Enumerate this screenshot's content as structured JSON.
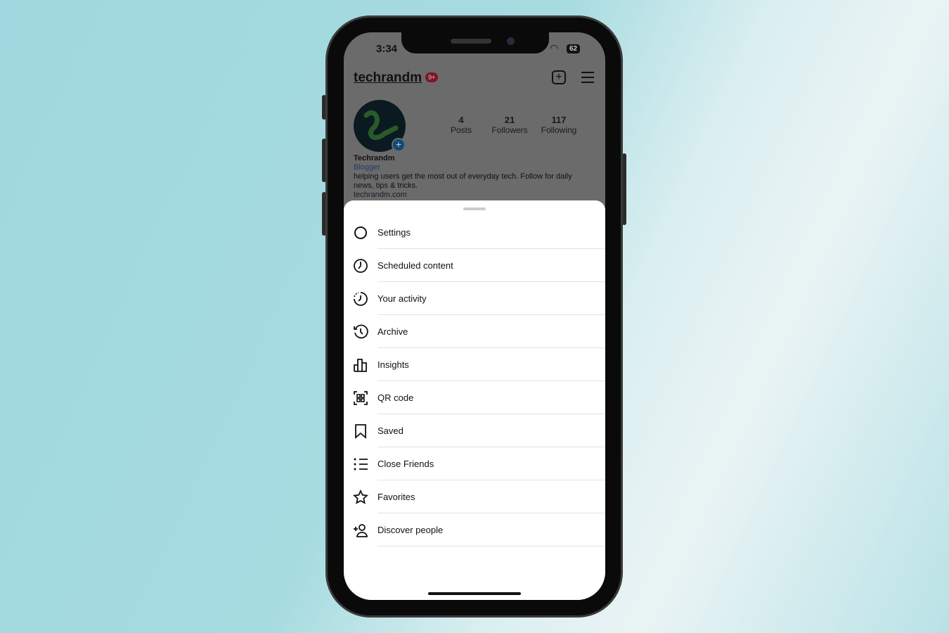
{
  "status_bar": {
    "time": "3:34",
    "battery": "62"
  },
  "profile": {
    "username": "techrandm",
    "notification_badge": "9+",
    "stats": [
      {
        "value": "4",
        "label": "Posts"
      },
      {
        "value": "21",
        "label": "Followers"
      },
      {
        "value": "117",
        "label": "Following"
      }
    ],
    "display_name": "Techrandm",
    "category": "Blogger",
    "bio": "helping users get the most out of everyday tech. Follow for daily news, tips & tricks.",
    "link": "techrandm.com"
  },
  "menu": {
    "items": [
      {
        "label": "Settings",
        "icon": "settings-icon"
      },
      {
        "label": "Scheduled content",
        "icon": "clock-icon"
      },
      {
        "label": "Your activity",
        "icon": "activity-icon",
        "highlighted": true
      },
      {
        "label": "Archive",
        "icon": "archive-icon"
      },
      {
        "label": "Insights",
        "icon": "insights-icon"
      },
      {
        "label": "QR code",
        "icon": "qr-code-icon"
      },
      {
        "label": "Saved",
        "icon": "bookmark-icon"
      },
      {
        "label": "Close Friends",
        "icon": "close-friends-icon"
      },
      {
        "label": "Favorites",
        "icon": "star-icon"
      },
      {
        "label": "Discover people",
        "icon": "add-person-icon"
      }
    ]
  },
  "colors": {
    "highlight": "#d9260f",
    "badge": "#e0243d"
  }
}
